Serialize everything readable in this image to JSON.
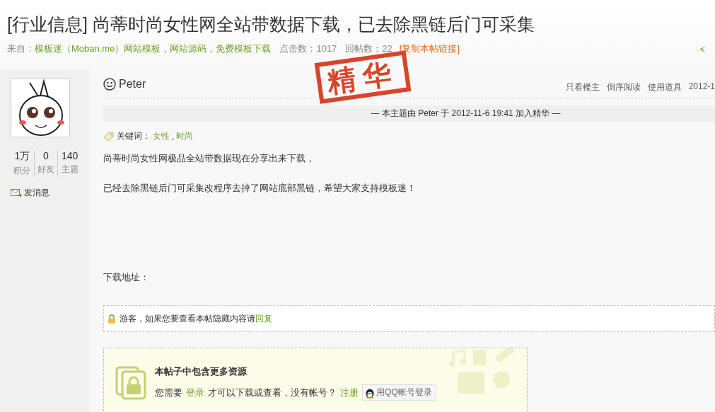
{
  "thread": {
    "title": "[行业信息] 尚蒂时尚女性网全站带数据下载，已去除黑链后门可采集",
    "source_label": "来自：",
    "source_link": "模板迷（Moban.me）网站模板，网站源码，免费模板下载",
    "views": "点击数：1017",
    "replies": "回帖数：22",
    "copy_link": "[复制本帖链接]",
    "nav": "<"
  },
  "stamp": "精华",
  "author": {
    "name": "Peter",
    "stats": [
      {
        "value": "1万",
        "label": "积分"
      },
      {
        "value": "0",
        "label": "好友"
      },
      {
        "value": "140",
        "label": "主题"
      }
    ],
    "message": "发消息"
  },
  "post": {
    "tools": [
      "只看楼主",
      "倒序阅读",
      "使用道具"
    ],
    "date": "2012-1",
    "notice": "— 本主题由 Peter 于 2012-11-6 19:41 加入精华 —",
    "keywords_label": "关键词：",
    "keywords": [
      "女性",
      "时尚"
    ],
    "keyword_separator": ",",
    "paragraphs": [
      "尚蒂时尚女性网极品全站带数据现在分享出来下载，",
      "已经去除黑链后门可采集改程序去掉了网站底部黑链，希望大家支持模板迷！"
    ],
    "download_label": "下载地址：",
    "hidden": {
      "text": "游客，如果您要查看本帖隐藏内容请",
      "link": "回复"
    },
    "locked": {
      "title": "本帖子中包含更多资源",
      "before": "您需要",
      "login": "登录",
      "after": "才可以下载或查看，没有帐号？",
      "register": "注册",
      "qq": "用QQ帐号登录"
    }
  }
}
